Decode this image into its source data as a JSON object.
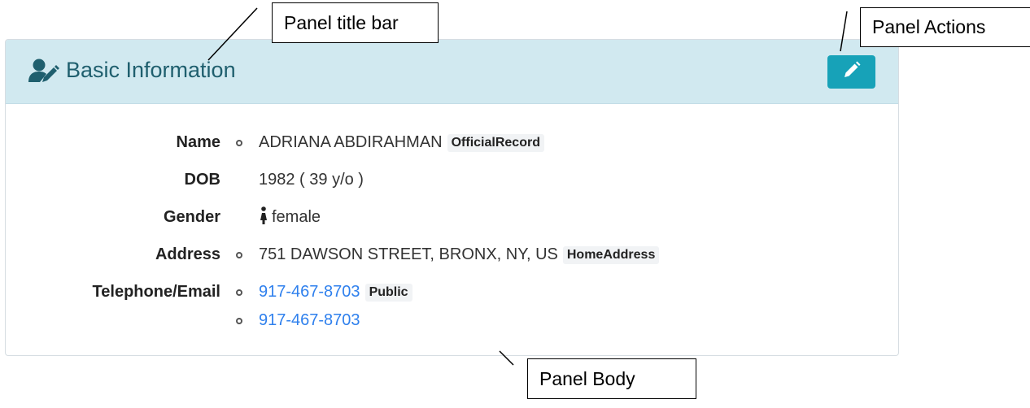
{
  "panel": {
    "title": "Basic Information",
    "title_icon": "user-edit-icon",
    "edit_icon": "pencil-icon",
    "colors": {
      "header_bg": "#d1e9f0",
      "title": "#1f5f6e",
      "action_button": "#17a2b8",
      "link": "#2f80ed"
    }
  },
  "fields": {
    "name": {
      "label": "Name",
      "value": "ADRIANA ABDIRAHMAN",
      "tag": "OfficialRecord"
    },
    "dob": {
      "label": "DOB",
      "value": "1982 ( 39 y/o )"
    },
    "gender": {
      "label": "Gender",
      "value": "female",
      "icon": "female-icon"
    },
    "address": {
      "label": "Address",
      "value": "751 DAWSON STREET, BRONX, NY, US",
      "tag": "HomeAddress"
    },
    "contact": {
      "label": "Telephone/Email",
      "items": [
        {
          "value": "917-467-8703",
          "tag": "Public"
        },
        {
          "value": "917-467-8703"
        }
      ]
    }
  },
  "callouts": {
    "title_bar": "Panel title bar",
    "actions": "Panel Actions",
    "body": "Panel Body"
  }
}
